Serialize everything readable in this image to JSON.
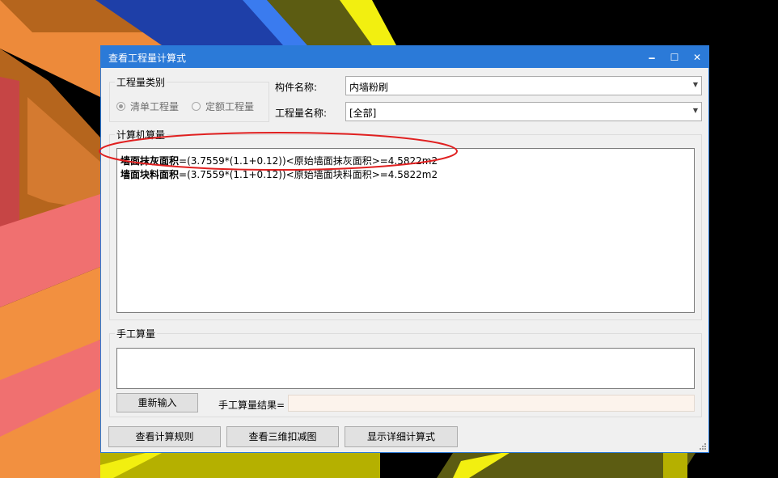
{
  "dialog": {
    "title": "查看工程量计算式",
    "controls": {
      "minimize": "🗕",
      "maximize": "☐",
      "close": "✕"
    }
  },
  "quantity_type": {
    "group_label": "工程量类别",
    "options": [
      {
        "label": "清单工程量",
        "selected": true
      },
      {
        "label": "定额工程量",
        "selected": false
      }
    ]
  },
  "component": {
    "label": "构件名称:",
    "value": "内墙粉刷"
  },
  "quantity_name": {
    "label": "工程量名称:",
    "value": "[全部]"
  },
  "computer_calc": {
    "group_label": "计算机算量",
    "lines": [
      {
        "name": "墙面抹灰面积",
        "formula": "=(3.7559*(1.1+0.12))<原始墙面抹灰面积>=4.5822m2"
      },
      {
        "name": "墙面块料面积",
        "formula": "=(3.7559*(1.1+0.12))<原始墙面块料面积>=4.5822m2"
      }
    ]
  },
  "manual_calc": {
    "group_label": "手工算量",
    "input_value": "",
    "reenter_button": "重新输入",
    "result_label": "手工算量结果=",
    "result_value": ""
  },
  "footer_buttons": {
    "view_rules": "查看计算规则",
    "view_3d": "查看三维扣减图",
    "show_detail": "显示详细计算式"
  },
  "colors": {
    "titlebar": "#2b7ad8",
    "annotation": "#e02020"
  }
}
